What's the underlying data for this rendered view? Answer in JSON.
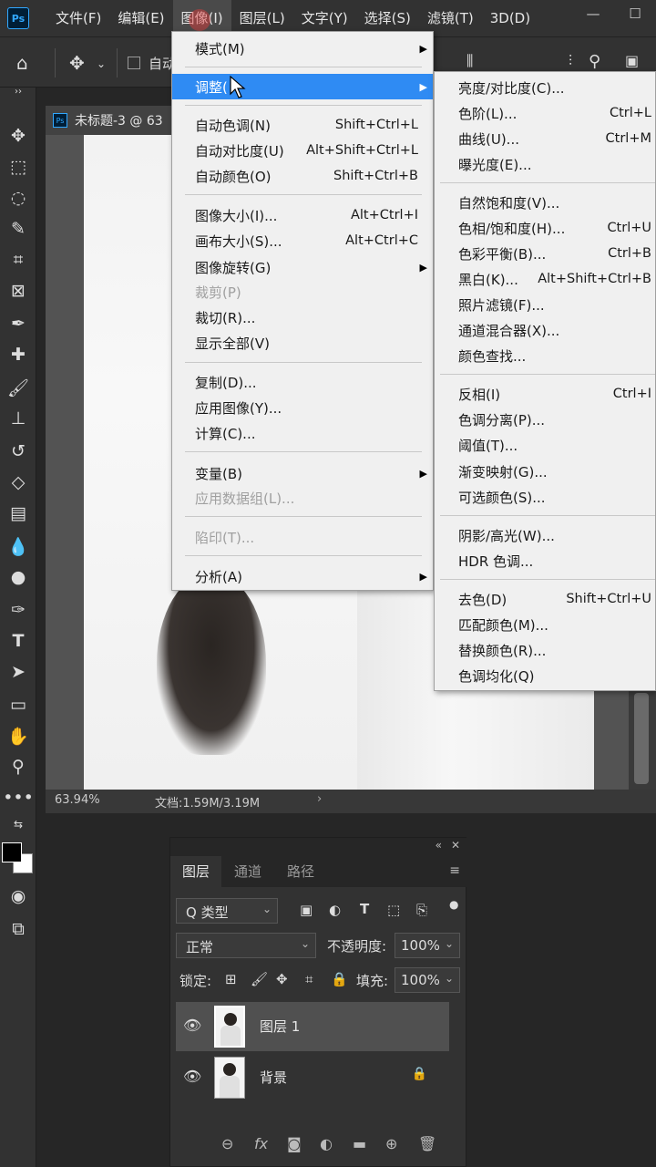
{
  "app": {
    "logo": "Ps",
    "menus": [
      "文件(F)",
      "编辑(E)",
      "图像(I)",
      "图层(L)",
      "文字(Y)",
      "选择(S)",
      "滤镜(T)",
      "3D(D)"
    ],
    "window_controls": [
      "—",
      "☐"
    ]
  },
  "options_bar": {
    "auto_label": "自动"
  },
  "document": {
    "tab_title": "未标题-3 @ 63",
    "tab_icon": "Ps",
    "zoom": "63.94%",
    "doc_info": "文档:1.59M/3.19M",
    "status_arrow": "›"
  },
  "image_menu": {
    "items": [
      {
        "label": "模式(M)",
        "shortcut": "",
        "submenu": true
      },
      {
        "label": "调整(",
        "shortcut": "",
        "submenu": true,
        "highlight": true
      },
      {
        "label": "自动色调(N)",
        "shortcut": "Shift+Ctrl+L"
      },
      {
        "label": "自动对比度(U)",
        "shortcut": "Alt+Shift+Ctrl+L"
      },
      {
        "label": "自动颜色(O)",
        "shortcut": "Shift+Ctrl+B"
      },
      {
        "label": "图像大小(I)...",
        "shortcut": "Alt+Ctrl+I"
      },
      {
        "label": "画布大小(S)...",
        "shortcut": "Alt+Ctrl+C"
      },
      {
        "label": "图像旋转(G)",
        "shortcut": "",
        "submenu": true
      },
      {
        "label": "裁剪(P)",
        "shortcut": "",
        "disabled": true
      },
      {
        "label": "裁切(R)...",
        "shortcut": ""
      },
      {
        "label": "显示全部(V)",
        "shortcut": ""
      },
      {
        "label": "复制(D)...",
        "shortcut": ""
      },
      {
        "label": "应用图像(Y)...",
        "shortcut": ""
      },
      {
        "label": "计算(C)...",
        "shortcut": ""
      },
      {
        "label": "变量(B)",
        "shortcut": "",
        "submenu": true
      },
      {
        "label": "应用数据组(L)...",
        "shortcut": "",
        "disabled": true
      },
      {
        "label": "陷印(T)...",
        "shortcut": "",
        "disabled": true
      },
      {
        "label": "分析(A)",
        "shortcut": "",
        "submenu": true
      }
    ]
  },
  "adjust_menu": {
    "items": [
      {
        "label": "亮度/对比度(C)...",
        "shortcut": ""
      },
      {
        "label": "色阶(L)...",
        "shortcut": "Ctrl+L"
      },
      {
        "label": "曲线(U)...",
        "shortcut": "Ctrl+M"
      },
      {
        "label": "曝光度(E)...",
        "shortcut": ""
      },
      {
        "label": "自然饱和度(V)...",
        "shortcut": ""
      },
      {
        "label": "色相/饱和度(H)...",
        "shortcut": "Ctrl+U"
      },
      {
        "label": "色彩平衡(B)...",
        "shortcut": "Ctrl+B"
      },
      {
        "label": "黑白(K)...",
        "shortcut": "Alt+Shift+Ctrl+B"
      },
      {
        "label": "照片滤镜(F)...",
        "shortcut": ""
      },
      {
        "label": "通道混合器(X)...",
        "shortcut": ""
      },
      {
        "label": "颜色查找...",
        "shortcut": ""
      },
      {
        "label": "反相(I)",
        "shortcut": "Ctrl+I"
      },
      {
        "label": "色调分离(P)...",
        "shortcut": ""
      },
      {
        "label": "阈值(T)...",
        "shortcut": ""
      },
      {
        "label": "渐变映射(G)...",
        "shortcut": ""
      },
      {
        "label": "可选颜色(S)...",
        "shortcut": ""
      },
      {
        "label": "阴影/高光(W)...",
        "shortcut": ""
      },
      {
        "label": "HDR 色调...",
        "shortcut": ""
      },
      {
        "label": "去色(D)",
        "shortcut": "Shift+Ctrl+U"
      },
      {
        "label": "匹配颜色(M)...",
        "shortcut": ""
      },
      {
        "label": "替换颜色(R)...",
        "shortcut": ""
      },
      {
        "label": "色调均化(Q)",
        "shortcut": ""
      }
    ]
  },
  "layers_panel": {
    "top_controls": [
      "«",
      "✕"
    ],
    "tabs": [
      "图层",
      "通道",
      "路径"
    ],
    "filter_label": "Q 类型",
    "blend_mode": "正常",
    "opacity_label": "不透明度:",
    "opacity_value": "100%",
    "lock_label": "锁定:",
    "fill_label": "填充:",
    "fill_value": "100%",
    "layers": [
      {
        "name": "图层 1",
        "selected": true
      },
      {
        "name": "背景",
        "locked": true
      }
    ]
  },
  "colors": {
    "menu_highlight": "#2f8bf3",
    "menu_bg": "#f0f0f0",
    "ui_dark": "#323232"
  }
}
